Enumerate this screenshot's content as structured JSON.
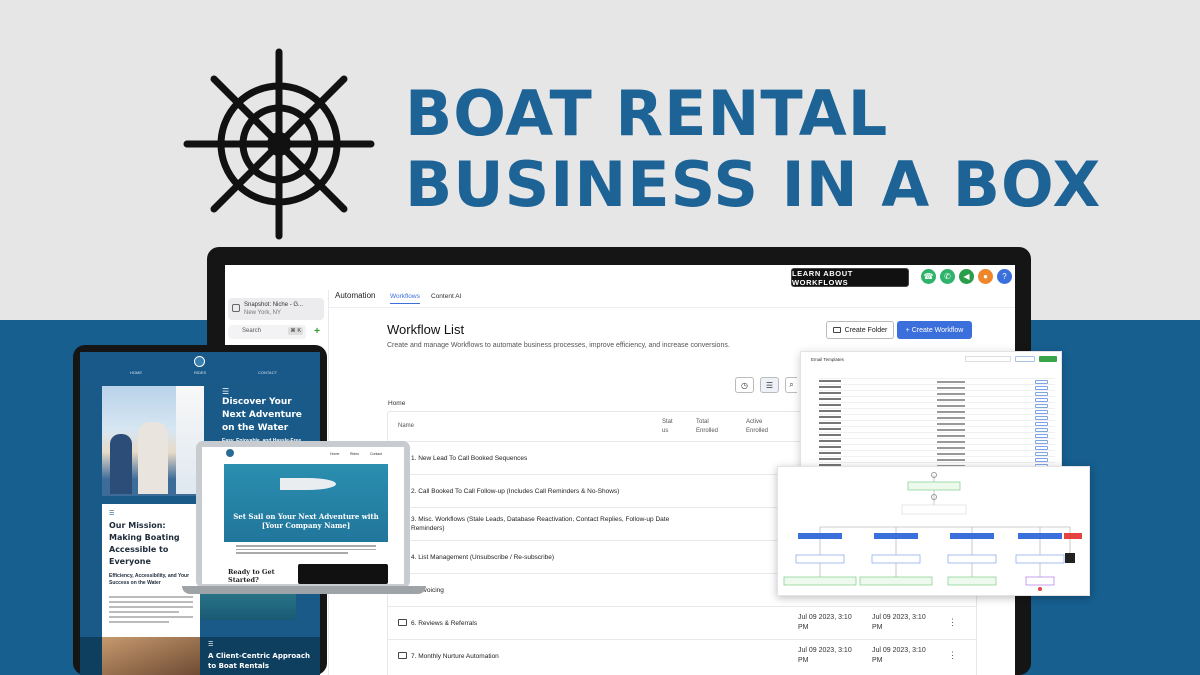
{
  "headline": {
    "line1": "BOAT RENTAL",
    "line2": "BUSINESS IN A BOX"
  },
  "colors": {
    "brand_blue": "#1d6395",
    "band_blue": "#165f8f",
    "accent_button": "#3b6fdb",
    "green": "#3aa44a"
  },
  "topbar": {
    "learn_label": "LEARN ABOUT WORKFLOWS",
    "icons": [
      "phone-icon",
      "call-icon",
      "megaphone-icon",
      "bell-icon",
      "help-icon"
    ]
  },
  "sidebar": {
    "snapshot_name": "Snapshot: Niche - G...",
    "snapshot_location": "New York, NY",
    "search_placeholder": "Search",
    "search_shortcut": "⌘ K"
  },
  "nav": {
    "section": "Automation",
    "tabs": [
      {
        "label": "Workflows"
      },
      {
        "label": "Content AI"
      }
    ]
  },
  "workflow_list": {
    "title": "Workflow List",
    "description": "Create and manage Workflows to automate business processes, improve efficiency, and increase conversions.",
    "create_folder_label": "Create Folder",
    "create_workflow_label": "+ Create Workflow",
    "breadcrumb": "Home",
    "columns": {
      "name": "Name",
      "status": "Stat us",
      "total": "Total Enrolled",
      "active": "Active Enrolled"
    },
    "rows": [
      {
        "name": "1. New Lead To Call Booked Sequences"
      },
      {
        "name": "2. Call Booked To Call Follow-up (Includes Call Reminders & No-Shows)"
      },
      {
        "name": "3. Misc. Workflows (Stale Leads, Database Reactivation, Contact Replies, Follow-up Date Reminders)"
      },
      {
        "name": "4. List Management (Unsubscribe / Re-subscribe)"
      },
      {
        "name": "5. Invoicing"
      },
      {
        "name": "6. Reviews & Referrals",
        "created": "Jul 09 2023, 3:10 PM",
        "updated": "Jul 09 2023, 3:10 PM"
      },
      {
        "name": "7. Monthly Nurture Automation",
        "created": "Jul 09 2023, 3:10 PM",
        "updated": "Jul 09 2023, 3:10 PM"
      }
    ]
  },
  "popup_email": {
    "title": "Email Templates",
    "rows": 15
  },
  "tablet": {
    "nav": [
      "HOME",
      "RIDES",
      "CONTACT"
    ],
    "hero_heading": "Discover Your Next Adventure on the Water",
    "hero_sub": "Easy, Enjoyable, and Hassle-Free Boat Rentals Await You!",
    "mission_heading": "Our Mission: Making Boating Accessible to Everyone",
    "mission_sub": "Efficiency, Accessibility, and Your Success on the Water",
    "bottom_heading": "A Client-Centric Approach to Boat Rentals"
  },
  "laptop": {
    "nav": [
      "Home",
      "Rides",
      "Contact"
    ],
    "hero_text": "Set Sail on Your Next Adventure with [Your Company Name]",
    "ready_text": "Ready to Get Started?"
  }
}
